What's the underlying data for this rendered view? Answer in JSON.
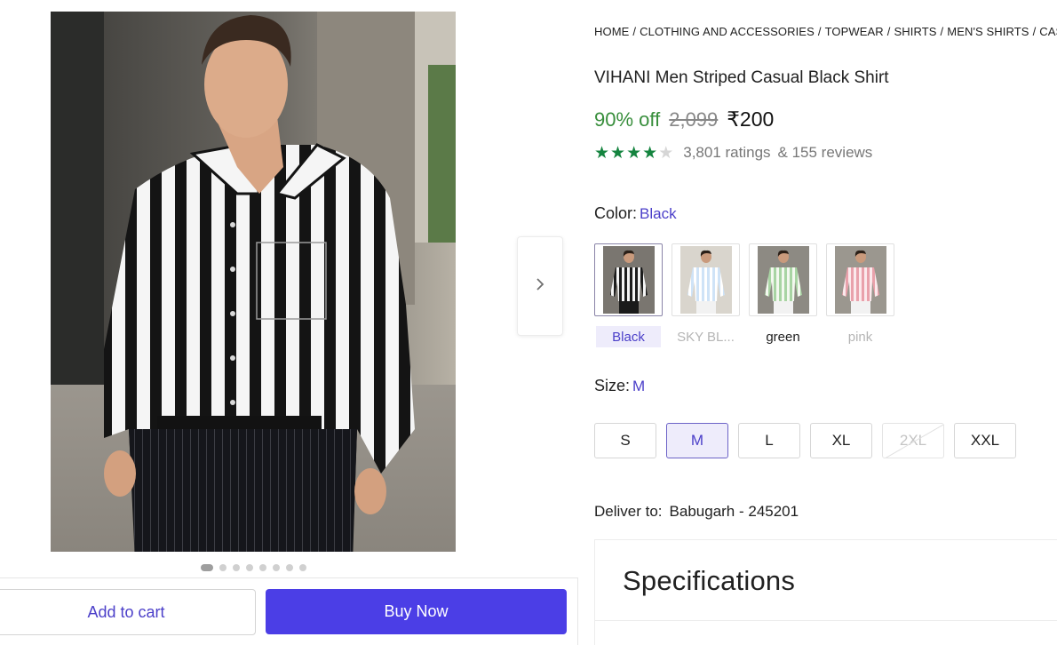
{
  "breadcrumb": [
    "HOME",
    "CLOTHING AND ACCESSORIES",
    "TOPWEAR",
    "SHIRTS",
    "MEN'S SHIRTS",
    "CASUAL"
  ],
  "breadcrumb_separator": "/",
  "product": {
    "title": "VIHANI Men Striped Casual Black Shirt",
    "discount": "90% off",
    "mrp": "2,099",
    "price": "₹200",
    "rating_stars": 4,
    "rating_max": 5,
    "ratings_text": "3,801 ratings",
    "reviews_text": "& 155 reviews"
  },
  "color": {
    "label": "Color:",
    "selected": "Black",
    "options": [
      {
        "name": "Black",
        "state": "selected",
        "shirt_color": "#1c1c1c",
        "stripe_color": "#f4f4f4",
        "bg_color": "#7a7670"
      },
      {
        "name": "SKY BL...",
        "state": "faded",
        "shirt_color": "#cfe3f7",
        "stripe_color": "#ffffff",
        "bg_color": "#d9d5cd"
      },
      {
        "name": "green",
        "state": "normal",
        "shirt_color": "#a8d4a3",
        "stripe_color": "#f3f8ef",
        "bg_color": "#8d8a83"
      },
      {
        "name": "pink",
        "state": "faded",
        "shirt_color": "#e9a1ab",
        "stripe_color": "#fbe9ec",
        "bg_color": "#9b978f"
      }
    ]
  },
  "size": {
    "label": "Size:",
    "selected": "M",
    "options": [
      {
        "name": "S",
        "state": "normal"
      },
      {
        "name": "M",
        "state": "selected"
      },
      {
        "name": "L",
        "state": "normal"
      },
      {
        "name": "XL",
        "state": "normal"
      },
      {
        "name": "2XL",
        "state": "disabled"
      },
      {
        "name": "XXL",
        "state": "normal"
      }
    ]
  },
  "delivery": {
    "label": "Deliver to:",
    "location": "Babugarh - 245201"
  },
  "specifications_heading": "Specifications",
  "gallery": {
    "dot_count": 8,
    "active_index": 0
  },
  "actions": {
    "add_to_cart": "Add to cart",
    "buy_now": "Buy Now"
  },
  "colors": {
    "accent": "#4b3ee6",
    "accent_text": "#4b3fc9",
    "discount_green": "#388e3c",
    "star_green": "#14843f"
  },
  "icons": {
    "next": "chevron-right-icon",
    "star": "star-icon"
  }
}
